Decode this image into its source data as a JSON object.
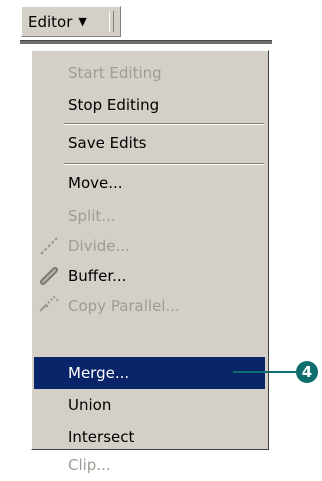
{
  "toolbar": {
    "editor_label": "Editor",
    "dropdown_arrow": "▼"
  },
  "menu": {
    "items": [
      {
        "label": "Start Editing",
        "disabled": true
      },
      {
        "label": "Stop Editing",
        "disabled": false
      },
      {
        "label": "Save Edits",
        "disabled": false
      },
      {
        "label": "Move...",
        "disabled": false
      },
      {
        "label": "Split...",
        "disabled": true
      },
      {
        "label": "Divide...",
        "disabled": true,
        "icon": "divide-icon"
      },
      {
        "label": "Buffer...",
        "disabled": false,
        "icon": "buffer-icon"
      },
      {
        "label": "Copy Parallel...",
        "disabled": true,
        "icon": "copy-parallel-icon"
      },
      {
        "label": "Merge...",
        "disabled": false,
        "selected": true
      },
      {
        "label": "Union",
        "disabled": false
      },
      {
        "label": "Intersect",
        "disabled": false
      },
      {
        "label": "Clip...",
        "disabled": true
      }
    ]
  },
  "callout": {
    "number": "4"
  },
  "colors": {
    "menu_bg": "#d4d0c8",
    "highlight": "#0a246a",
    "callout": "#0f6d6d"
  }
}
